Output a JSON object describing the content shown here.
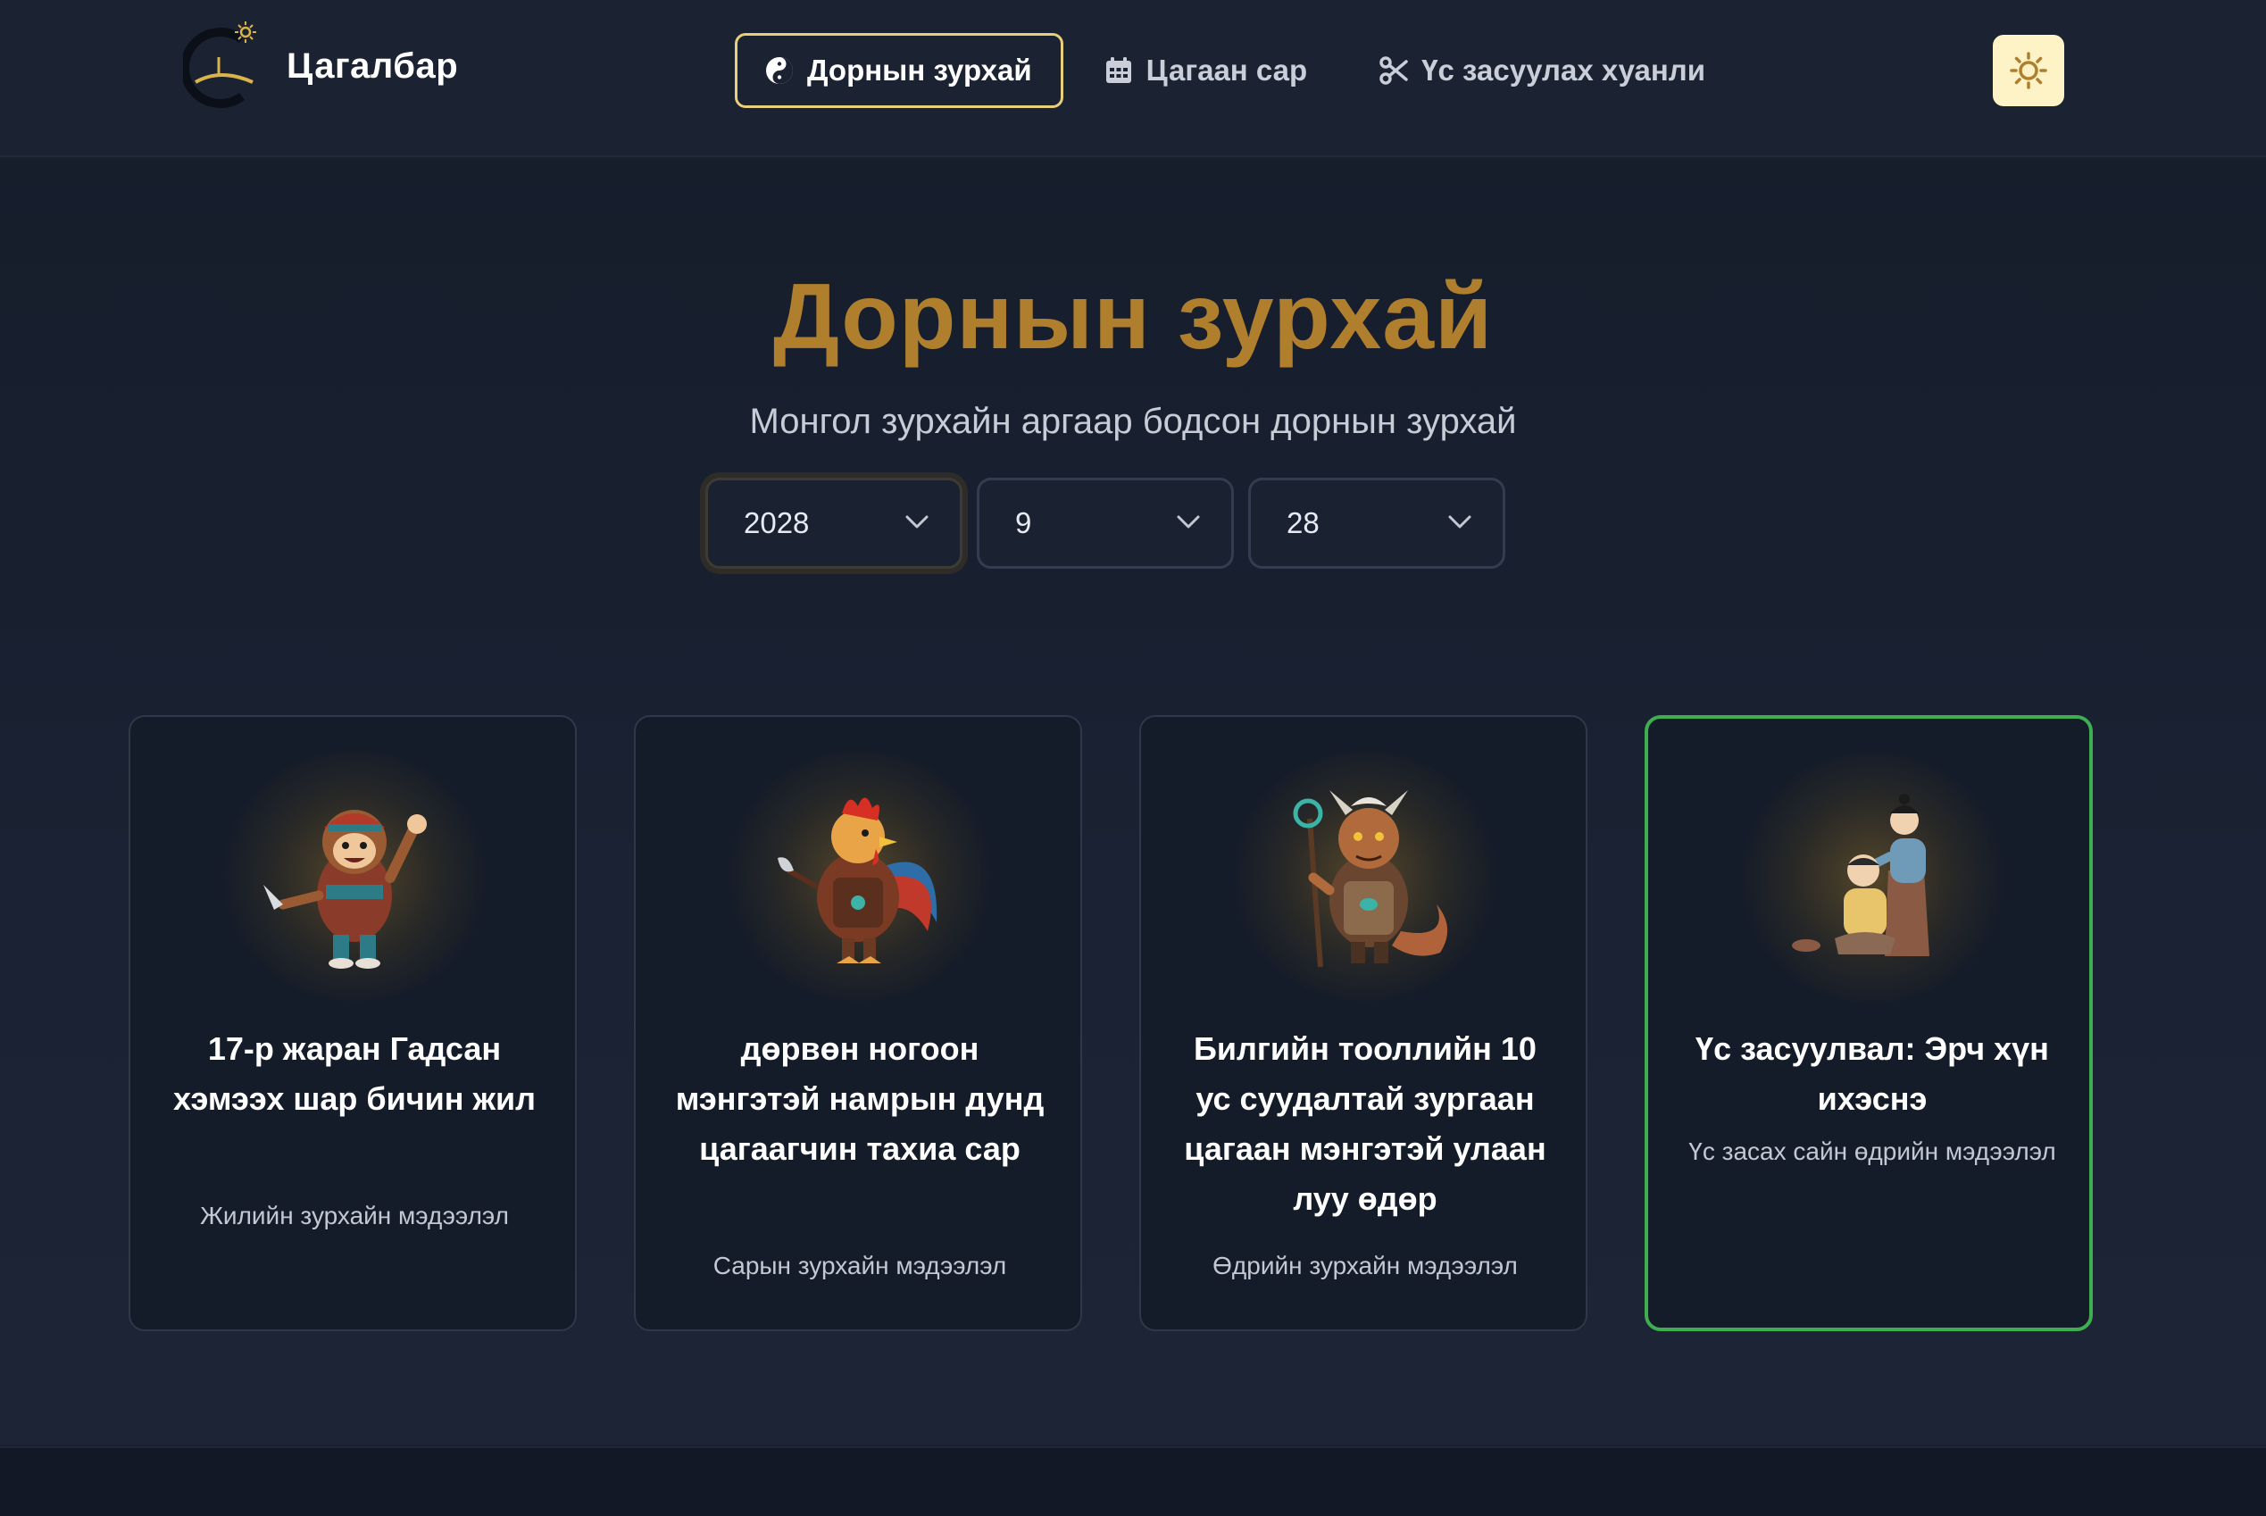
{
  "header": {
    "brand": "Цагалбар",
    "nav": [
      {
        "label": "Дорнын зурхай",
        "icon": "yin-yang-icon",
        "active": true
      },
      {
        "label": "Цагаан сар",
        "icon": "calendar-icon",
        "active": false
      },
      {
        "label": "Үс засуулах хуанли",
        "icon": "scissors-icon",
        "active": false
      }
    ],
    "theme_toggle_icon": "sun-icon"
  },
  "hero": {
    "title": "Дорнын зурхай",
    "subtitle": "Монгол зурхайн аргаар бодсон дорнын зурхай",
    "selects": [
      {
        "name": "year",
        "value": "2028"
      },
      {
        "name": "month",
        "value": "9"
      },
      {
        "name": "day",
        "value": "28"
      }
    ]
  },
  "cards": [
    {
      "title": "17-р жаран Гадсан хэмээх шар бичин жил",
      "subtitle": "Жилийн зурхайн мэдээлэл",
      "icon": "monkey-warrior-illustration"
    },
    {
      "title": "дөрвөн ногоон мэнгэтэй намрын дунд цагаагчин тахиа сар",
      "subtitle": "Сарын зурхайн мэдээлэл",
      "icon": "rooster-warrior-illustration"
    },
    {
      "title": "Билгийн тооллийн 10 ус суудалтай зургаан цагаан мэнгэтэй улаан луу өдөр",
      "subtitle": "Өдрийн зурхайн мэдээлэл",
      "icon": "dragon-warrior-illustration"
    },
    {
      "title": "Үс засуулвал: Эрч хүн ихэснэ",
      "subtitle": "Үс засах сайн өдрийн мэдээлэл",
      "icon": "haircut-illustration",
      "highlighted": true
    }
  ],
  "colors": {
    "background": "#182030",
    "accent_gold": "#b07f2e",
    "active_border": "#e8cf7a",
    "highlight_green": "#3fae51"
  }
}
